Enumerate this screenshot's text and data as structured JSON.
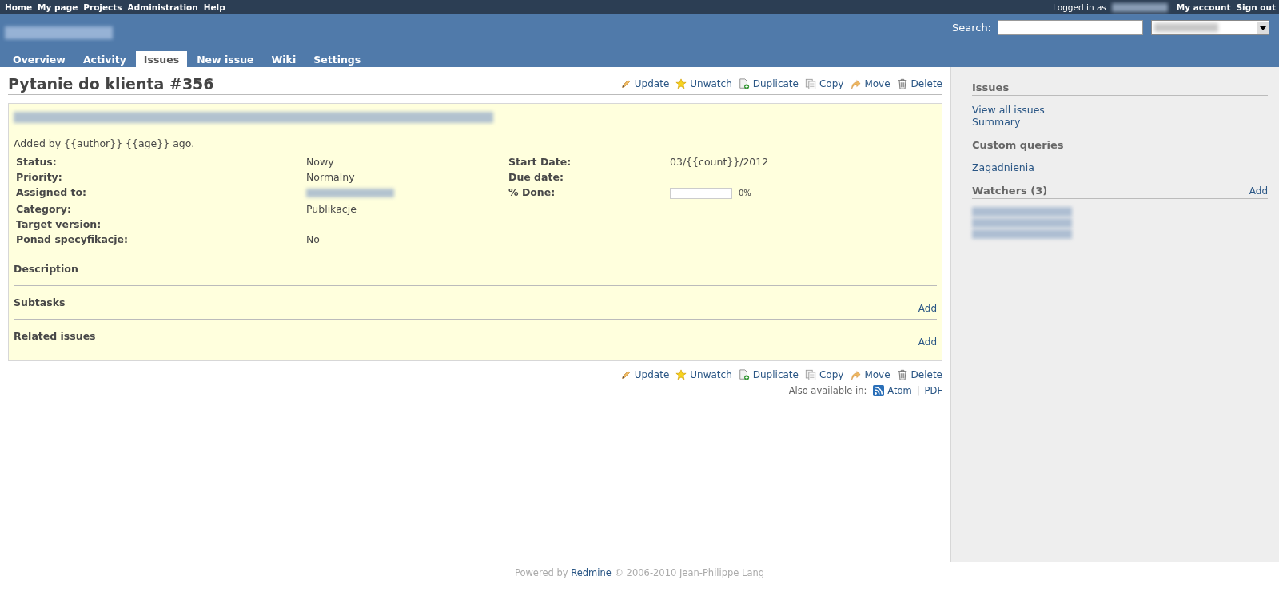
{
  "top_menu": [
    "Home",
    "My page",
    "Projects",
    "Administration",
    "Help"
  ],
  "account": {
    "logged_in_label": "Logged in as",
    "links": [
      "My account",
      "Sign out"
    ]
  },
  "search": {
    "label": "Search:"
  },
  "tabs": [
    {
      "label": "Overview",
      "selected": false
    },
    {
      "label": "Activity",
      "selected": false
    },
    {
      "label": "Issues",
      "selected": true
    },
    {
      "label": "New issue",
      "selected": false
    },
    {
      "label": "Wiki",
      "selected": false
    },
    {
      "label": "Settings",
      "selected": false
    }
  ],
  "issue": {
    "title": "Pytanie do klienta #356",
    "actions": [
      {
        "kind": "edit",
        "label": "Update"
      },
      {
        "kind": "watch",
        "label": "Unwatch"
      },
      {
        "kind": "duplicate",
        "label": "Duplicate"
      },
      {
        "kind": "copy",
        "label": "Copy"
      },
      {
        "kind": "move",
        "label": "Move"
      },
      {
        "kind": "delete",
        "label": "Delete"
      }
    ],
    "added_by": "Added by {{author}} {{age}} ago.",
    "attributes": [
      [
        {
          "label": "Status:",
          "kind": "text",
          "value": "Nowy"
        },
        {
          "label": "Start Date:",
          "kind": "text",
          "value": "03/{{count}}/2012"
        }
      ],
      [
        {
          "label": "Priority:",
          "kind": "text",
          "value": "Normalny"
        },
        {
          "label": "Due date:",
          "kind": "empty"
        }
      ],
      [
        {
          "label": "Assigned to:",
          "kind": "redacted"
        },
        {
          "label": "% Done:",
          "kind": "progress",
          "level": 0,
          "reading": "0%"
        }
      ],
      [
        {
          "label": "Category:",
          "kind": "text",
          "value": "Publikacje"
        }
      ],
      [
        {
          "label": "Target version:",
          "kind": "text",
          "value": "-"
        }
      ],
      [
        {
          "label": "Ponad specyfikacje:",
          "kind": "text",
          "value": "No"
        }
      ]
    ],
    "sections": [
      {
        "title": "Description"
      },
      {
        "title": "Subtasks",
        "add": "Add"
      },
      {
        "title": "Related issues",
        "add": "Add"
      }
    ],
    "bottom_actions": [
      {
        "kind": "edit",
        "label": "Update"
      },
      {
        "kind": "watch",
        "label": "Unwatch"
      },
      {
        "kind": "duplicate",
        "label": "Duplicate"
      },
      {
        "kind": "copy",
        "label": "Copy"
      },
      {
        "kind": "move",
        "label": "Move"
      },
      {
        "kind": "delete",
        "label": "Delete"
      }
    ],
    "also_available": {
      "label": "Also available in:",
      "links": [
        {
          "kind": "atom",
          "label": "Atom"
        },
        {
          "kind": "pdf",
          "label": "PDF"
        }
      ],
      "separator": "|"
    }
  },
  "sidebar": {
    "sections": [
      {
        "title": "Issues",
        "links": [
          "View all issues",
          "Summary"
        ]
      },
      {
        "title": "Custom queries",
        "links": [
          "Zagadnienia"
        ]
      },
      {
        "title": "Watchers (3)",
        "add": "Add",
        "kind": "watchers"
      }
    ]
  },
  "footer": {
    "before": "Powered by ",
    "link": "Redmine",
    "after": " © 2006-2010 Jean-Philippe Lang"
  }
}
